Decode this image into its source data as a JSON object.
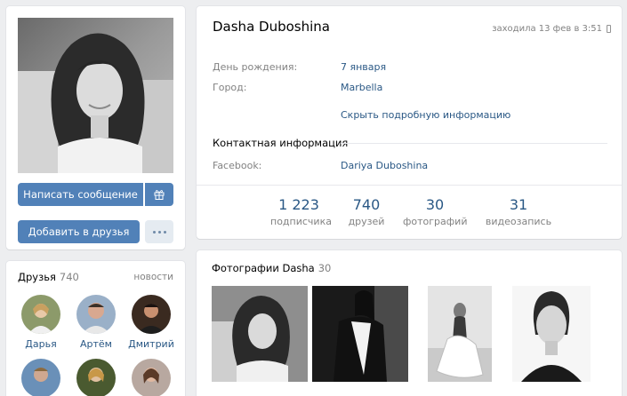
{
  "profile": {
    "name": "Dasha Duboshina",
    "last_seen": "заходила 13 фев в 3:51"
  },
  "actions": {
    "write_message": "Написать сообщение",
    "add_friend": "Добавить в друзья"
  },
  "info": {
    "birthday_label": "День рождения:",
    "birthday_value": "7 января",
    "city_label": "Город:",
    "city_value": "Marbella",
    "toggle_details": "Скрыть подробную информацию",
    "contacts_title": "Контактная информация",
    "facebook_label": "Facebook:",
    "facebook_value": "Dariya Duboshina"
  },
  "counters": [
    {
      "value": "1 223",
      "label": "подписчика"
    },
    {
      "value": "740",
      "label": "друзей"
    },
    {
      "value": "30",
      "label": "фотографий"
    },
    {
      "value": "31",
      "label": "видеозапись"
    }
  ],
  "friends": {
    "title": "Друзья",
    "count": "740",
    "news": "новости",
    "items": [
      {
        "name": "Дарья"
      },
      {
        "name": "Артём"
      },
      {
        "name": "Дмитрий"
      },
      {
        "name": ""
      },
      {
        "name": ""
      },
      {
        "name": ""
      }
    ]
  },
  "photos": {
    "title": "Фотографии Dasha",
    "count": "30"
  },
  "icons": {
    "gift": "gift-icon",
    "more": "more-dots-icon",
    "mobile": "mobile-phone-icon"
  },
  "colors": {
    "accent": "#5181b8",
    "link": "#2a5885",
    "muted": "#828282",
    "background": "#edeef0"
  }
}
